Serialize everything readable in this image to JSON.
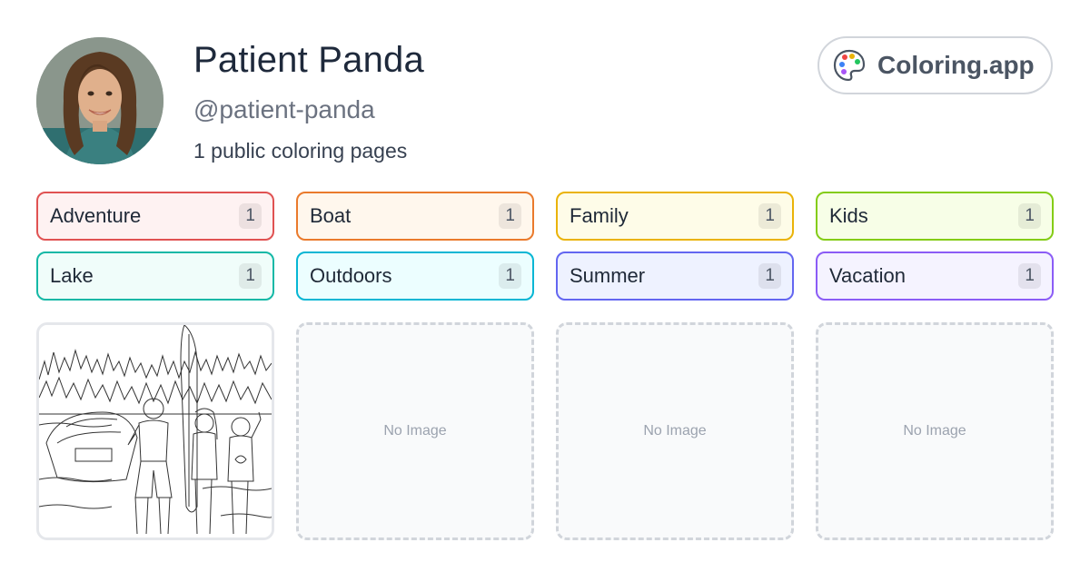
{
  "profile": {
    "name": "Patient Panda",
    "handle": "@patient-panda",
    "summary": "1 public coloring pages"
  },
  "brand": {
    "label": "Coloring.app",
    "icon": "palette-icon"
  },
  "tags": [
    {
      "label": "Adventure",
      "count": "1",
      "border": "#e05252",
      "bg": "#fef2f2"
    },
    {
      "label": "Boat",
      "count": "1",
      "border": "#ea7a2c",
      "bg": "#fff7ed"
    },
    {
      "label": "Family",
      "count": "1",
      "border": "#eab308",
      "bg": "#fefce8"
    },
    {
      "label": "Kids",
      "count": "1",
      "border": "#84cc16",
      "bg": "#f7fee7"
    },
    {
      "label": "Lake",
      "count": "1",
      "border": "#14b8a6",
      "bg": "#f0fdfa"
    },
    {
      "label": "Outdoors",
      "count": "1",
      "border": "#06b6d4",
      "bg": "#ecfeff"
    },
    {
      "label": "Summer",
      "count": "1",
      "border": "#6366f1",
      "bg": "#eef2ff"
    },
    {
      "label": "Vacation",
      "count": "1",
      "border": "#8b5cf6",
      "bg": "#f5f3ff"
    }
  ],
  "cards": [
    {
      "has_image": true,
      "placeholder": ""
    },
    {
      "has_image": false,
      "placeholder": "No Image"
    },
    {
      "has_image": false,
      "placeholder": "No Image"
    },
    {
      "has_image": false,
      "placeholder": "No Image"
    }
  ]
}
